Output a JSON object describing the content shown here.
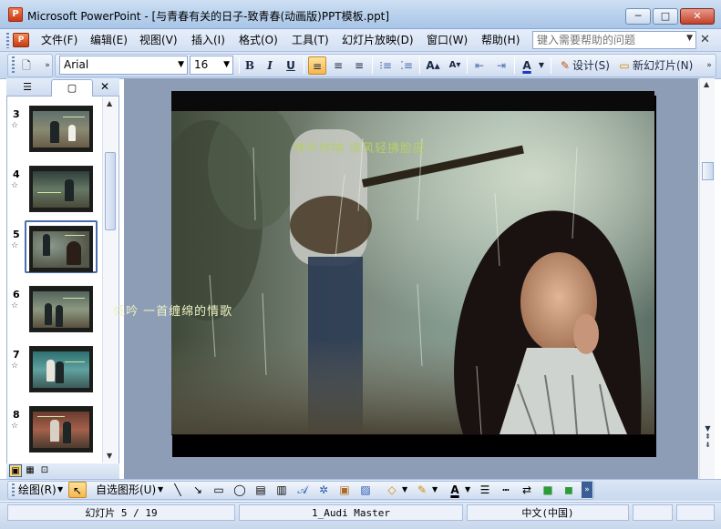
{
  "window": {
    "app_icon_text": "P",
    "title": "Microsoft PowerPoint - [与青春有关的日子-致青春(动画版)PPT模板.ppt]",
    "minimize": "─",
    "maximize": "□",
    "close": "✕"
  },
  "menu": {
    "items": [
      "文件(F)",
      "编辑(E)",
      "视图(V)",
      "插入(I)",
      "格式(O)",
      "工具(T)",
      "幻灯片放映(D)",
      "窗口(W)",
      "帮助(H)"
    ],
    "help_placeholder": "键入需要帮助的问题",
    "close": "✕"
  },
  "toolbar": {
    "font_name": "Arial",
    "font_size": "16",
    "bold": "B",
    "italic": "I",
    "underline": "U",
    "design_label": "设计(S)",
    "new_slide_label": "新幻灯片(N)"
  },
  "slides_panel": {
    "close": "✕",
    "thumbnails": [
      {
        "number": "3",
        "star": "☆"
      },
      {
        "number": "4",
        "star": "☆"
      },
      {
        "number": "5",
        "star": "☆"
      },
      {
        "number": "6",
        "star": "☆"
      },
      {
        "number": "7",
        "star": "☆"
      },
      {
        "number": "8",
        "star": "☆"
      }
    ]
  },
  "slide": {
    "text_top": "林叶作响  凉风轻拂脸庞",
    "text_bottom": "低吟  一首缠绵的情歌"
  },
  "drawing_toolbar": {
    "draw_label": "绘图(R)",
    "autoshapes_label": "自选图形(U)"
  },
  "status": {
    "slide_position": "幻灯片 5 / 19",
    "design_name": "1_Audi Master",
    "language": "中文(中国)"
  }
}
